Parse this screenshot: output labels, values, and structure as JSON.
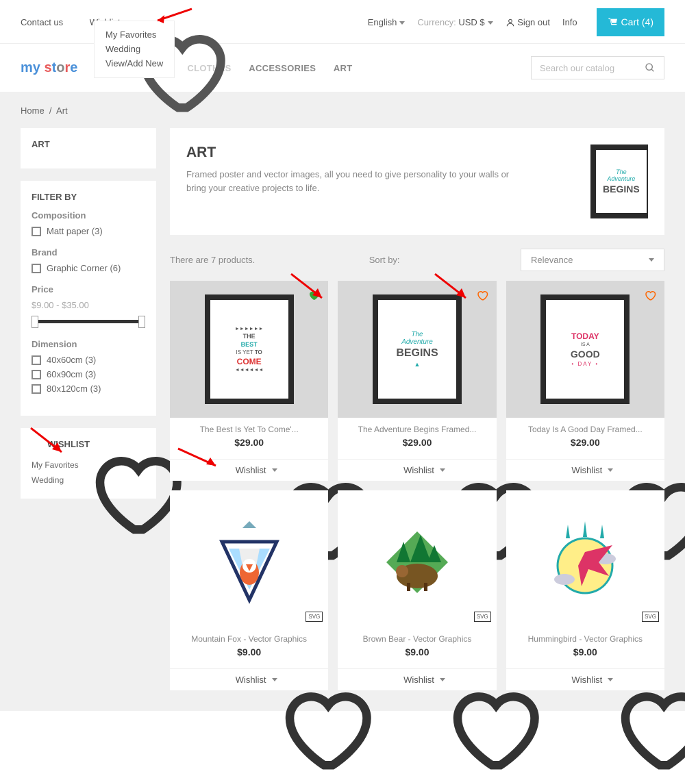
{
  "topbar": {
    "contact": "Contact us",
    "wishlist": "Wishlist",
    "language": "English",
    "currency_label": "Currency:",
    "currency": "USD $",
    "signout": "Sign out",
    "info": "Info",
    "cart": "Cart (4)"
  },
  "dropdown": {
    "item1": "My Favorites",
    "item2": "Wedding",
    "item3": "View/Add New"
  },
  "logo": {
    "p1": "my",
    "p2": "store"
  },
  "nav": {
    "clothes": "CLOTHES",
    "accessories": "ACCESSORIES",
    "art": "ART"
  },
  "search": {
    "placeholder": "Search our catalog"
  },
  "breadcrumb": {
    "home": "Home",
    "art": "Art"
  },
  "sidebar_title": "ART",
  "filter": {
    "heading": "FILTER BY",
    "composition": "Composition",
    "matt": "Matt paper (3)",
    "brand": "Brand",
    "graphic": "Graphic Corner (6)",
    "price": "Price",
    "price_range": "$9.00 - $35.00",
    "dimension": "Dimension",
    "d1": "40x60cm (3)",
    "d2": "60x90cm (3)",
    "d3": "80x120cm (3)"
  },
  "wishlist_box": {
    "title": "WISHLIST",
    "i1": "My Favorites",
    "i2": "Wedding"
  },
  "hero": {
    "title": "ART",
    "desc": "Framed poster and vector images, all you need to give personality to your walls or bring your creative projects to life."
  },
  "list": {
    "count": "There are 7 products.",
    "sortby": "Sort by:",
    "relevance": "Relevance"
  },
  "wishlabel": "Wishlist",
  "products": [
    {
      "title": "The Best Is Yet To Come'...",
      "price": "$29.00"
    },
    {
      "title": "The Adventure Begins Framed...",
      "price": "$29.00"
    },
    {
      "title": "Today Is A Good Day Framed...",
      "price": "$29.00"
    },
    {
      "title": "Mountain Fox - Vector Graphics",
      "price": "$9.00"
    },
    {
      "title": "Brown Bear - Vector Graphics",
      "price": "$9.00"
    },
    {
      "title": "Hummingbird - Vector Graphics",
      "price": "$9.00"
    }
  ]
}
